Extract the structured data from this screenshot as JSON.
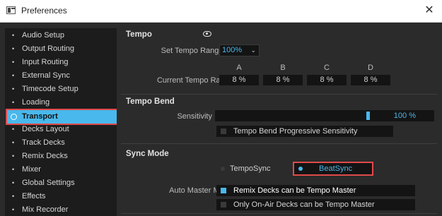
{
  "window": {
    "title": "Preferences"
  },
  "sidebar": {
    "items": [
      {
        "label": "Audio Setup"
      },
      {
        "label": "Output Routing"
      },
      {
        "label": "Input Routing"
      },
      {
        "label": "External Sync"
      },
      {
        "label": "Timecode Setup"
      },
      {
        "label": "Loading"
      },
      {
        "label": "Transport",
        "selected": true
      },
      {
        "label": "Decks Layout"
      },
      {
        "label": "Track Decks"
      },
      {
        "label": "Remix Decks"
      },
      {
        "label": "Mixer"
      },
      {
        "label": "Global Settings"
      },
      {
        "label": "Effects"
      },
      {
        "label": "Mix Recorder"
      }
    ]
  },
  "tempo": {
    "title": "Tempo",
    "set_range_label": "Set Tempo Range To",
    "set_range_value": "100%",
    "current_range_label": "Current Tempo Range",
    "columns": [
      "A",
      "B",
      "C",
      "D"
    ],
    "values": [
      "8 %",
      "8 %",
      "8 %",
      "8 %"
    ]
  },
  "tempo_bend": {
    "title": "Tempo Bend",
    "sensitivity_label": "Sensitivity",
    "sensitivity_value": "100 %",
    "sensitivity_level": 0.7,
    "progressive_label": "Tempo Bend Progressive Sensitivity",
    "progressive_checked": false
  },
  "sync_mode": {
    "title": "Sync Mode",
    "options": [
      {
        "label": "TempoSync",
        "selected": false
      },
      {
        "label": "BeatSync",
        "selected": true
      }
    ],
    "auto_master_label": "Auto Master Mode",
    "remix_master_label": "Remix Decks can be Tempo Master",
    "remix_master_checked": true,
    "onair_label": "Only On-Air Decks can be Tempo Master",
    "onair_checked": false
  },
  "colors": {
    "accent": "#49b8ec",
    "highlight_border": "#e04a4a",
    "panel": "#2b2b2b",
    "field": "#141414"
  },
  "icons": [
    "app-icon",
    "close-icon",
    "eye-icon",
    "chevron-down-icon"
  ]
}
